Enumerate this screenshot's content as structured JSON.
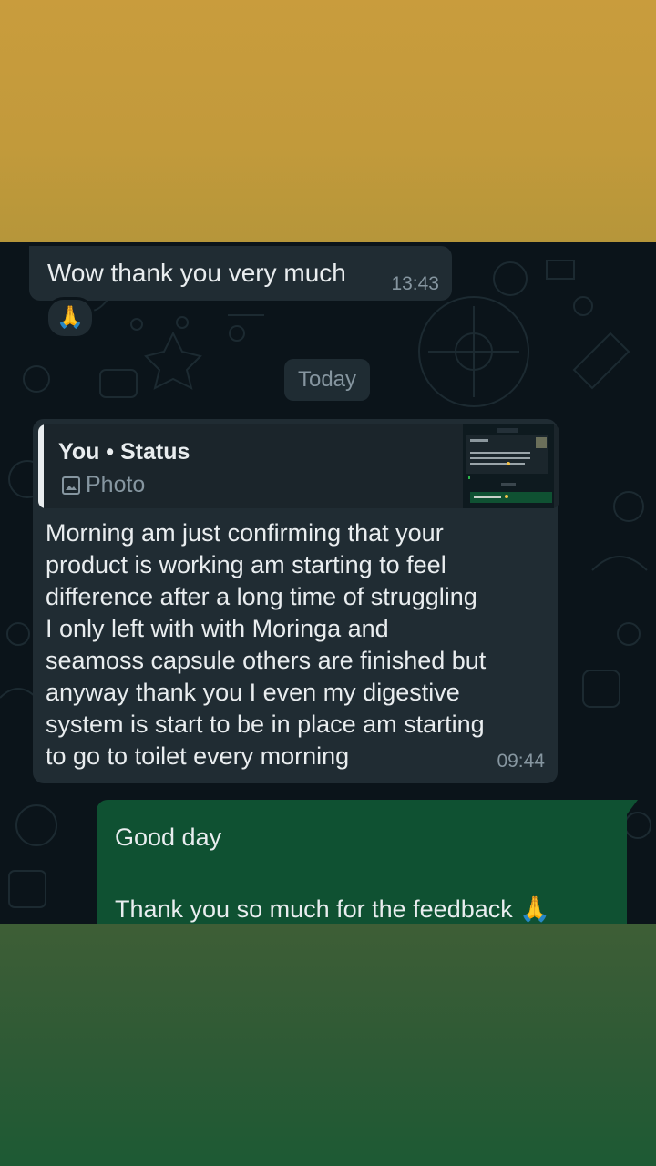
{
  "messages": {
    "m1": {
      "text": "Wow thank you very much",
      "time": "13:43",
      "reaction": "🙏"
    },
    "date_divider": "Today",
    "m2": {
      "quote_author": "You • Status",
      "quote_type": "Photo",
      "body": [
        "Morning am just confirming that your",
        "product is working am starting to feel",
        "difference after a long time of struggling",
        "I only left with with Moringa and",
        "seamoss capsule others are finished but",
        "anyway thank you I even my digestive",
        "system is start to be in place am starting",
        "to go to toilet every morning"
      ],
      "time": "09:44"
    },
    "m3": {
      "line1": "Good day",
      "line2": "Thank you so much for the feedback",
      "emoji": "🙏"
    }
  },
  "colors": {
    "top_band": "#c99c3d",
    "bottom_band": "#1d5a34",
    "chat_bg": "#0b141a",
    "incoming_bubble": "#202c33",
    "outgoing_bubble": "#0f5132"
  },
  "icons": [
    "photo-icon",
    "pray-emoji"
  ]
}
